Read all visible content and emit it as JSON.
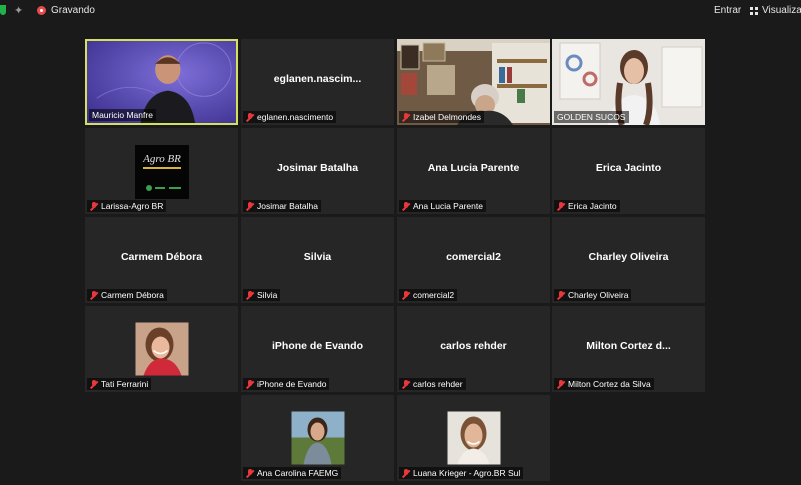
{
  "topbar": {
    "recording_label": "Gravando",
    "enter_label": "Entrar",
    "view_label": "Visualizar"
  },
  "participants": [
    {
      "display": "",
      "label": "Mauricio Manfre",
      "type": "video",
      "muted": false
    },
    {
      "display": "eglanen.nascim...",
      "label": "eglanen.nascimento",
      "type": "name",
      "muted": true
    },
    {
      "display": "",
      "label": "Izabel Delmondes",
      "type": "video",
      "muted": true
    },
    {
      "display": "",
      "label": "GOLDEN SUCOS",
      "type": "video",
      "muted": false
    },
    {
      "display": "",
      "label": "Larissa-Agro BR",
      "type": "avatar",
      "muted": true
    },
    {
      "display": "Josimar Batalha",
      "label": "Josimar Batalha",
      "type": "name",
      "muted": true
    },
    {
      "display": "Ana Lucia Parente",
      "label": "Ana Lucia Parente",
      "type": "name",
      "muted": true
    },
    {
      "display": "Erica Jacinto",
      "label": "Erica Jacinto",
      "type": "name",
      "muted": true
    },
    {
      "display": "Carmem Débora",
      "label": "Carmem Débora",
      "type": "name",
      "muted": true
    },
    {
      "display": "Silvia",
      "label": "Silvia",
      "type": "name",
      "muted": true
    },
    {
      "display": "comercial2",
      "label": "comercial2",
      "type": "name",
      "muted": true
    },
    {
      "display": "Charley Oliveira",
      "label": "Charley Oliveira",
      "type": "name",
      "muted": true
    },
    {
      "display": "",
      "label": "Tati Ferrarini",
      "type": "avatar",
      "muted": true
    },
    {
      "display": "iPhone de Evando",
      "label": "iPhone de Evando",
      "type": "name",
      "muted": true
    },
    {
      "display": "carlos rehder",
      "label": "carlos rehder",
      "type": "name",
      "muted": true
    },
    {
      "display": "Milton  Cortez  d...",
      "label": "Milton Cortez da Silva",
      "type": "name",
      "muted": true
    },
    {
      "display": "",
      "label": "Ana Carolina FAEMG",
      "type": "avatar",
      "muted": true
    },
    {
      "display": "",
      "label": "Luana Krieger - Agro.BR Sul",
      "type": "avatar",
      "muted": true
    }
  ],
  "colors": {
    "background": "#1a1a1a",
    "tile": "#262626",
    "active_speaker_border": "#d6e05a",
    "muted_icon": "#e8383b",
    "recording": "#e84b4b"
  }
}
